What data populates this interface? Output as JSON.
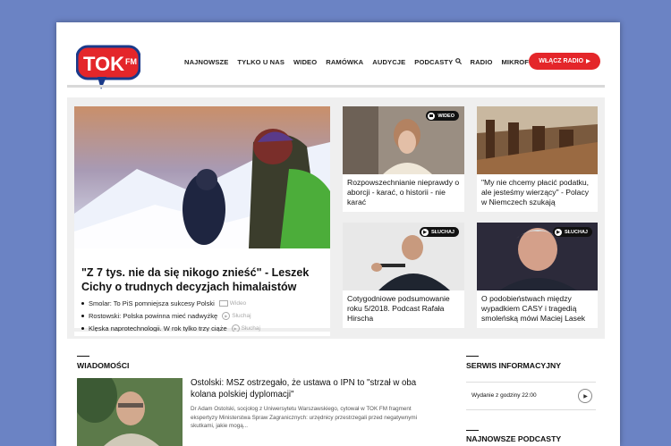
{
  "header": {
    "logo_text": "TOK FM",
    "nav": [
      {
        "label": "NAJNOWSZE"
      },
      {
        "label": "TYLKO U NAS"
      },
      {
        "label": "WIDEO"
      },
      {
        "label": "RAMÓWKA"
      },
      {
        "label": "AUDYCJE"
      },
      {
        "label": "PODCASTY"
      },
      {
        "label": "RADIO"
      },
      {
        "label": "MIKROFON"
      }
    ],
    "radio_button": "WŁĄCZ RADIO"
  },
  "featured": {
    "title": "\"Z 7 tys. nie da się nikogo znieść\" - Leszek Cichy o trudnych decyzjach himalaistów",
    "bullets": [
      {
        "text": "Smolar: To PiS pomniejsza sukcesy Polski",
        "tag": "Wideo"
      },
      {
        "text": "Rostowski: Polska powinna mieć nadwyżkę",
        "tag": "Słuchaj"
      },
      {
        "text": "Klęska naprotechnologii. W rok tylko trzy ciąże",
        "tag": "Słuchaj"
      }
    ]
  },
  "cards": [
    {
      "caption": "Rozpowszechnianie nieprawdy o aborcji - karać, o historii - nie karać",
      "badge": "WIDEO"
    },
    {
      "caption": "\"My nie chcemy płacić podatku, ale jesteśmy wierzący\" - Polacy w Niemczech szukają",
      "badge": ""
    },
    {
      "caption": "Cotygodniowe podsumowanie roku 5/2018. Podcast Rafała Hirscha",
      "badge": "SŁUCHAJ"
    },
    {
      "caption": "O podobieństwach między wypadkiem CASY i tragedią smoleńską mówi Maciej Lasek",
      "badge": "SŁUCHAJ"
    }
  ],
  "news": {
    "section": "WIADOMOŚCI",
    "title": "Ostolski: MSZ ostrzegało, że ustawa o IPN to \"strzał w oba kolana polskiej dyplomacji\"",
    "body": "Dr Adam Ostolski, socjolog z Uniwersytetu Warszawskiego, cytował w TOK FM fragment ekspertyzy Ministerstwa Spraw Zagranicznych: urzędnicy przestrzegali przed negatywnymi skutkami, jakie mogą..."
  },
  "serwis": {
    "section": "SERWIS INFORMACYJNY",
    "edition": "Wydanie z godziny 22:00"
  },
  "podcasts": {
    "section": "NAJNOWSZE PODCASTY"
  },
  "colors": {
    "brand_red": "#e4262a",
    "brand_blue": "#1a3a8a",
    "background": "#6b83c4"
  }
}
